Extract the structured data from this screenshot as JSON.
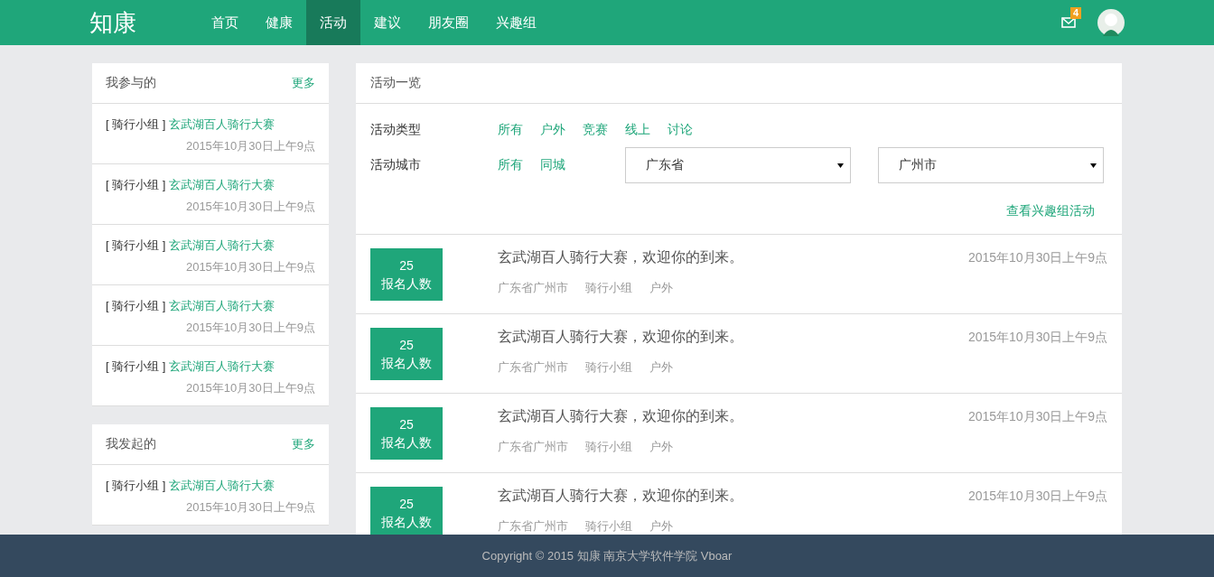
{
  "logo": "知康",
  "nav": [
    {
      "label": "首页",
      "selected": false
    },
    {
      "label": "健康",
      "selected": false
    },
    {
      "label": "活动",
      "selected": true
    },
    {
      "label": "建议",
      "selected": false
    },
    {
      "label": "朋友圈",
      "selected": false
    },
    {
      "label": "兴趣组",
      "selected": false
    }
  ],
  "mail_badge": "4",
  "sidebar": [
    {
      "title": "我参与的",
      "more": "更多",
      "items": [
        {
          "group": "[ 骑行小组 ]",
          "name": "玄武湖百人骑行大赛",
          "time": "2015年10月30日上午9点"
        },
        {
          "group": "[ 骑行小组 ]",
          "name": "玄武湖百人骑行大赛",
          "time": "2015年10月30日上午9点"
        },
        {
          "group": "[ 骑行小组 ]",
          "name": "玄武湖百人骑行大赛",
          "time": "2015年10月30日上午9点"
        },
        {
          "group": "[ 骑行小组 ]",
          "name": "玄武湖百人骑行大赛",
          "time": "2015年10月30日上午9点"
        },
        {
          "group": "[ 骑行小组 ]",
          "name": "玄武湖百人骑行大赛",
          "time": "2015年10月30日上午9点"
        }
      ]
    },
    {
      "title": "我发起的",
      "more": "更多",
      "items": [
        {
          "group": "[ 骑行小组 ]",
          "name": "玄武湖百人骑行大赛",
          "time": "2015年10月30日上午9点"
        }
      ]
    }
  ],
  "main": {
    "title": "活动一览",
    "type_filter": {
      "label": "活动类型",
      "options": [
        "所有",
        "户外",
        "竞赛",
        "线上",
        "讨论"
      ]
    },
    "city_filter": {
      "label": "活动城市",
      "options": [
        "所有",
        "同城"
      ],
      "province": "广东省",
      "city": "广州市"
    },
    "group_link": "查看兴趣组活动",
    "activities": [
      {
        "count": "25",
        "count_label": "报名人数",
        "title": "玄武湖百人骑行大赛，欢迎你的到来。",
        "time": "2015年10月30日上午9点",
        "tags": [
          "广东省广州市",
          "骑行小组",
          "户外"
        ]
      },
      {
        "count": "25",
        "count_label": "报名人数",
        "title": "玄武湖百人骑行大赛，欢迎你的到来。",
        "time": "2015年10月30日上午9点",
        "tags": [
          "广东省广州市",
          "骑行小组",
          "户外"
        ]
      },
      {
        "count": "25",
        "count_label": "报名人数",
        "title": "玄武湖百人骑行大赛，欢迎你的到来。",
        "time": "2015年10月30日上午9点",
        "tags": [
          "广东省广州市",
          "骑行小组",
          "户外"
        ]
      },
      {
        "count": "25",
        "count_label": "报名人数",
        "title": "玄武湖百人骑行大赛，欢迎你的到来。",
        "time": "2015年10月30日上午9点",
        "tags": [
          "广东省广州市",
          "骑行小组",
          "户外"
        ]
      }
    ]
  },
  "footer": "Copyright © 2015 知康 南京大学软件学院 Vboar"
}
